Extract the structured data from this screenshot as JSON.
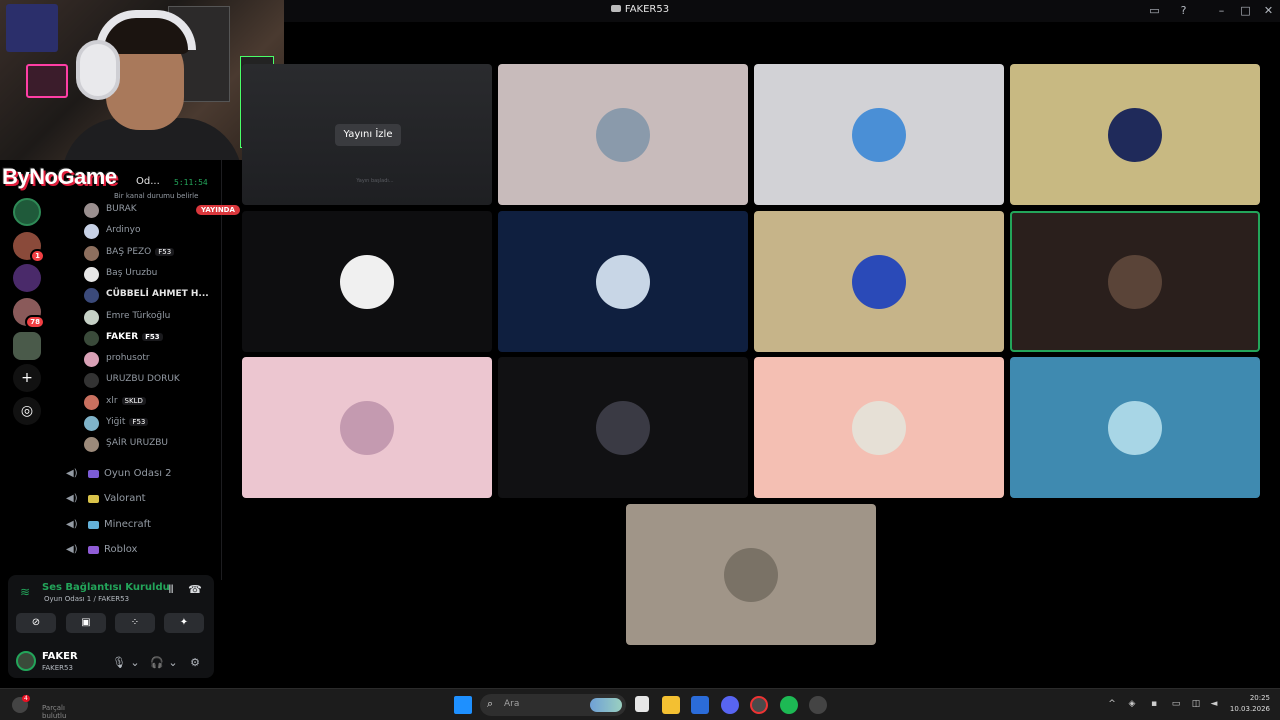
{
  "window": {
    "title": "FAKER53"
  },
  "logo_text": "ByNoGame",
  "channel_header": {
    "name": "Od...",
    "timer": "5:11:54",
    "status": "Bir kanal durumu belirle"
  },
  "members": [
    {
      "name": "BURAK",
      "live": "YAYINDA",
      "color": "#9a8f8f"
    },
    {
      "name": "Ardinyo",
      "color": "#c7d1e6"
    },
    {
      "name": "BAŞ PEZO",
      "tag": "F53",
      "color": "#8d6f5e"
    },
    {
      "name": "Baş Uruzbu",
      "color": "#e6e6e6"
    },
    {
      "name": "CÜBBELİ AHMET H...",
      "bold": true,
      "color": "#3b4a7a"
    },
    {
      "name": "Emre Türkoğlu",
      "color": "#c6d1c6"
    },
    {
      "name": "FAKER",
      "tag": "F53",
      "me": true,
      "color": "#3a4a3a"
    },
    {
      "name": "prohusotr",
      "color": "#d9a1b6"
    },
    {
      "name": "URUZBU DORUK",
      "color": "#333"
    },
    {
      "name": "xlr",
      "tag": "SKLD",
      "color": "#c9705f"
    },
    {
      "name": "Yiğit",
      "tag": "F53",
      "color": "#7fb3c9"
    },
    {
      "name": "ŞAİR URUZBU",
      "color": "#9c8a7a"
    }
  ],
  "voice_channels": [
    {
      "label": "Oyun Odası 2",
      "color": "#7c5cd6"
    },
    {
      "label": "Valorant",
      "color": "#d9c34a"
    },
    {
      "label": "Minecraft",
      "color": "#63b1d9"
    },
    {
      "label": "Roblox",
      "color": "#8f5cd6"
    }
  ],
  "voice_panel": {
    "connection": "Ses Bağlantısı Kuruldu",
    "room": "Oyun Odası 1 / FAKER53"
  },
  "user": {
    "name": "FAKER",
    "status": "FAKER53"
  },
  "stream_tile": {
    "watch_label": "Yayını İzle",
    "description": "Yayın başladı..."
  },
  "tiles": [
    {
      "bg": "#c8bbbb",
      "avatar": "#8a9aab"
    },
    {
      "bg": "#d2d2d6",
      "avatar": "#4a8fd6"
    },
    {
      "bg": "#c8b982",
      "avatar": "#1f2a5a"
    },
    {
      "bg": "#0e0e10",
      "avatar": "#f0f0f0"
    },
    {
      "bg": "#0f1f3f",
      "avatar": "#c8d6e6"
    },
    {
      "bg": "#c6b489",
      "avatar": "#2a4ab8"
    },
    {
      "bg": "#2a1f1c",
      "avatar": "#5a4438",
      "speaking": true
    },
    {
      "bg": "#ecc6d0",
      "avatar": "#c49ab0"
    },
    {
      "bg": "#111113",
      "avatar": "#3a3a44"
    },
    {
      "bg": "#f4bfb3",
      "avatar": "#e6e0d6"
    },
    {
      "bg": "#3f8ab0",
      "avatar": "#a8d6e6"
    },
    {
      "bg": "#a09588",
      "avatar": "#7a7266"
    }
  ],
  "taskbar": {
    "search_placeholder": "Ara",
    "weather_badge": "4",
    "weather_text": "Parçalı bulutlu",
    "time": "20:25",
    "date": "10.03.2026"
  },
  "icons": {
    "minimize": "minimize-icon",
    "maximize": "maximize-icon",
    "close": "close-icon",
    "help": "help-icon",
    "inbox": "inbox-icon"
  }
}
